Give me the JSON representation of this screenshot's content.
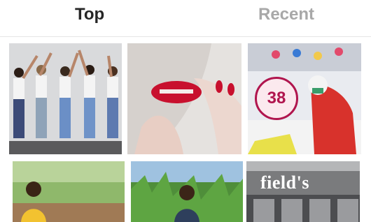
{
  "tabs": {
    "top": "Top",
    "recent": "Recent"
  },
  "grid": {
    "tiles": [
      {
        "subject": "women-in-jeans-group-photo"
      },
      {
        "subject": "red-lips-and-nails-closeup"
      },
      {
        "subject": "garment-factory-worker",
        "badge": "38"
      },
      {
        "subject": "woman-in-yellow-in-field"
      },
      {
        "subject": "woman-in-cornfield"
      },
      {
        "subject": "store-facade",
        "sign_text": "field's"
      }
    ]
  },
  "colors": {
    "active_tab": "#262626",
    "inactive_tab": "#a8a8a8",
    "badge_accent": "#b0154e"
  }
}
